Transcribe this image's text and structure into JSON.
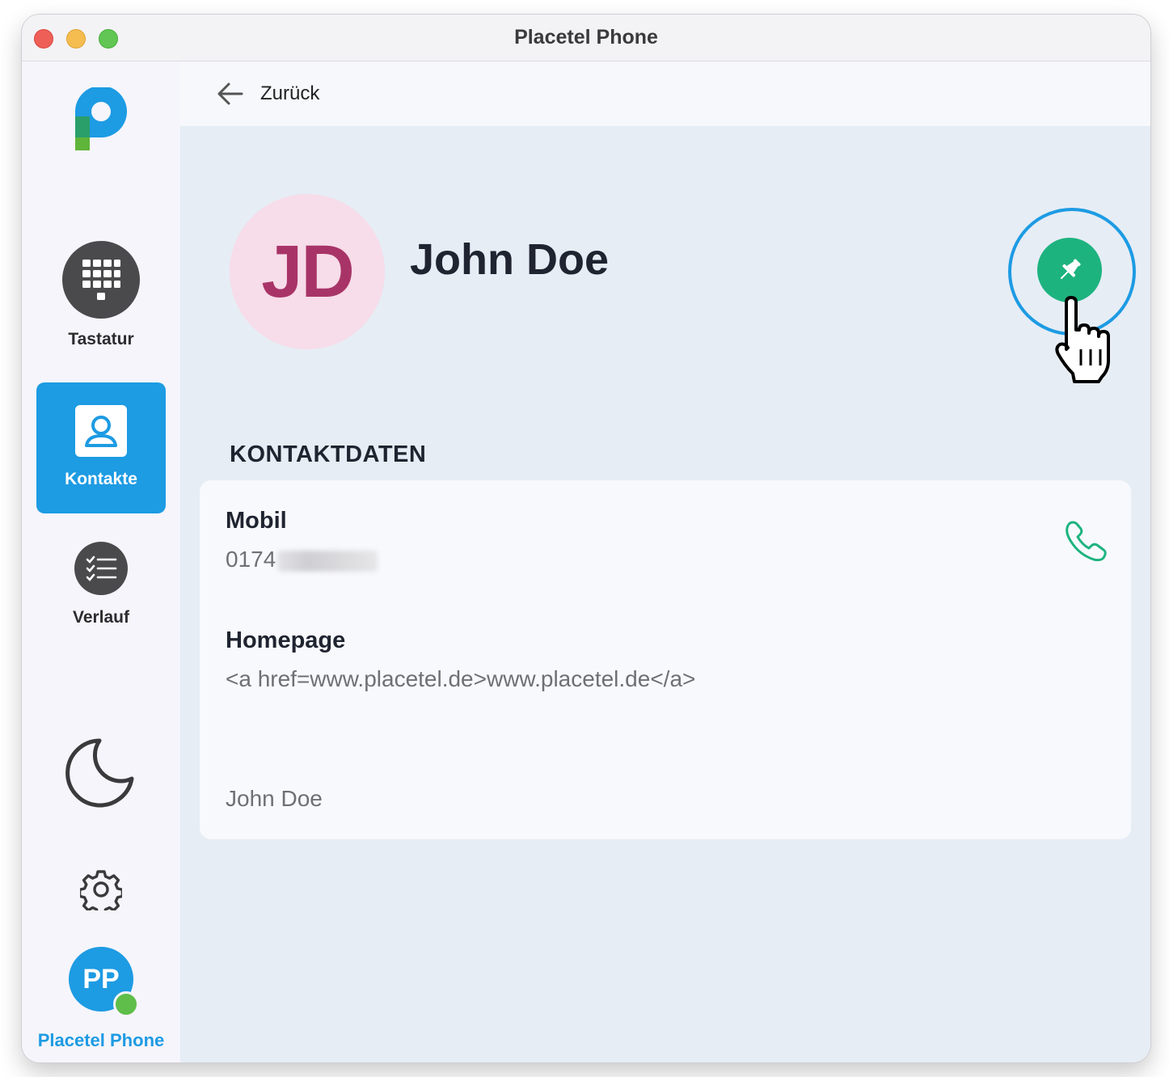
{
  "window": {
    "title": "Placetel Phone"
  },
  "sidebar": {
    "logo": "placetel-logo",
    "items": [
      {
        "label": "Tastatur",
        "icon": "dialpad-icon",
        "active": false
      },
      {
        "label": "Kontakte",
        "icon": "contact-icon",
        "active": true
      },
      {
        "label": "Verlauf",
        "icon": "history-list-icon",
        "active": false
      }
    ],
    "dark_mode_icon": "moon-icon",
    "settings_icon": "gear-icon",
    "user": {
      "initials": "PP",
      "name": "Placetel Phone",
      "status": "online"
    }
  },
  "header": {
    "back_label": "Zurück"
  },
  "contact": {
    "initials": "JD",
    "name": "John Doe",
    "pin_icon": "pin-icon"
  },
  "details": {
    "section_title": "KONTAKTDATEN",
    "mobile_label": "Mobil",
    "mobile_value": "0174",
    "homepage_label": "Homepage",
    "homepage_value": "<a href=www.placetel.de>www.placetel.de</a>",
    "footer_name": "John Doe"
  },
  "colors": {
    "accent": "#1d9be3",
    "pin_green": "#1db37f",
    "avatar_bg": "#f7dce9",
    "avatar_text": "#a83467",
    "online": "#5fbe4a"
  }
}
